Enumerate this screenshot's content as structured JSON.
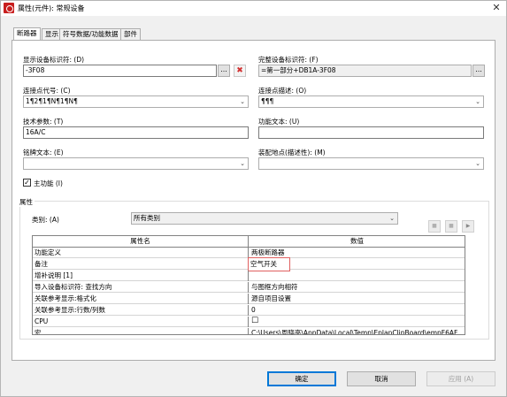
{
  "window": {
    "title": "属性(元件): 常规设备",
    "close_glyph": "✕"
  },
  "tabs": [
    {
      "label": "断路器"
    },
    {
      "label": "显示"
    },
    {
      "label": "符号数据/功能数据"
    },
    {
      "label": "部件"
    }
  ],
  "form": {
    "display_dt_label": "显示设备标识符: (D)",
    "display_dt_value": "-3F08",
    "full_dt_label": "完整设备标识符: (F)",
    "full_dt_value": "=第一部分+DB1A-3F08",
    "conn_code_label": "连接点代号: (C)",
    "conn_code_value": "1¶2¶1¶N¶1¶N¶",
    "conn_desc_label": "连接点描述: (O)",
    "conn_desc_value": "¶¶¶",
    "tech_param_label": "技术参数: (T)",
    "tech_param_value": "16A/C",
    "func_text_label": "功能文本: (U)",
    "func_text_value": "",
    "nameplate_label": "铭牌文本: (E)",
    "nameplate_value": "",
    "mount_loc_label": "装配地点(描述性): (M)",
    "mount_loc_value": "",
    "main_function_label": "主功能 (I)",
    "main_function_checked": "✓",
    "browse_glyph": "...",
    "delete_glyph": "✖",
    "chevron": "⌄"
  },
  "properties": {
    "group_title": "属性",
    "category_label": "类别: (A)",
    "category_value": "所有类别",
    "header_name": "属性名",
    "header_value": "数值",
    "rows": [
      {
        "name": "功能定义",
        "value": "两极断路器"
      },
      {
        "name": "备注",
        "value": "空气开关"
      },
      {
        "name": "增补说明 [1]",
        "value": ""
      },
      {
        "name": "导入设备标识符: 查找方向",
        "value": "与图框方向相符"
      },
      {
        "name": "关联参考显示:格式化",
        "value": "源自项目设置"
      },
      {
        "name": "关联参考显示:行数/列数",
        "value": "0"
      },
      {
        "name": "CPU",
        "value": "☐"
      },
      {
        "name": "宏",
        "value": "C:\\Users\\周晓亮\\AppData\\Local\\Temp\\EplanClipBoard\\empF6AF...."
      }
    ]
  },
  "buttons": {
    "ok": "确定",
    "cancel": "取消",
    "apply": "应用 (A)"
  }
}
